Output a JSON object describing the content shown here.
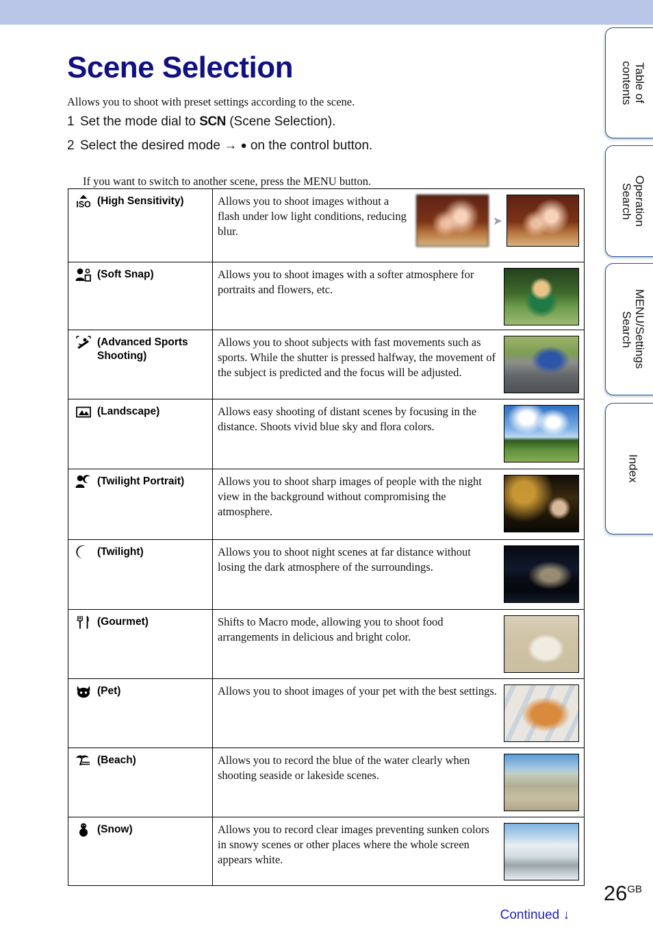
{
  "header": {
    "title": "Scene Selection",
    "band_color": "#b9c6e8",
    "title_color": "#101080"
  },
  "intro": "Allows you to shoot with preset settings according to the scene.",
  "steps": [
    {
      "number": "1",
      "text_before": "Set the mode dial to",
      "glyph": "SCN",
      "text_after": "(Scene Selection)."
    },
    {
      "number": "2",
      "text_before": "Select the desired mode",
      "arrow": "→",
      "dot": "●",
      "text_after": "on the control button."
    }
  ],
  "step_note": "If you want to switch to another scene, press the MENU button.",
  "table": {
    "rows": [
      {
        "icon": "high-sensitivity-icon",
        "label": "(High Sensitivity)",
        "description": "Allows you to shoot images without a flash under low light conditions, reducing blur.",
        "thumbnails": [
          "blurred-dinner-photo",
          "sharp-dinner-photo"
        ],
        "has_arrow": true
      },
      {
        "icon": "soft-snap-icon",
        "label": "(Soft Snap)",
        "description": "Allows you to shoot images with a softer atmosphere for portraits and flowers, etc.",
        "thumbnails": [
          "boy-in-grass-photo"
        ],
        "has_arrow": false
      },
      {
        "icon": "advanced-sports-shooting-icon",
        "label": "(Advanced Sports Shooting)",
        "description": "Allows you to shoot subjects with fast movements such as sports. While the shutter is pressed halfway, the movement of the subject is predicted and the focus will be adjusted.",
        "thumbnails": [
          "motorcycle-racer-photo"
        ],
        "has_arrow": false
      },
      {
        "icon": "landscape-icon",
        "label": "(Landscape)",
        "description": "Allows easy shooting of distant scenes by focusing in the distance. Shoots vivid blue sky and flora colors.",
        "thumbnails": [
          "field-and-sky-photo"
        ],
        "has_arrow": false
      },
      {
        "icon": "twilight-portrait-icon",
        "label": "(Twilight Portrait)",
        "description": "Allows you to shoot sharp images of people with the night view in the background without compromising the atmosphere.",
        "thumbnails": [
          "man-with-night-city-photo"
        ],
        "has_arrow": false
      },
      {
        "icon": "twilight-icon",
        "label": "(Twilight)",
        "description": "Allows you to shoot night scenes at far distance without losing the dark atmosphere of the surroundings.",
        "thumbnails": [
          "night-bridge-photo"
        ],
        "has_arrow": false
      },
      {
        "icon": "gourmet-icon",
        "label": "(Gourmet)",
        "description": "Shifts to Macro mode, allowing you to shoot food arrangements in delicious and bright color.",
        "thumbnails": [
          "plated-food-photo"
        ],
        "has_arrow": false
      },
      {
        "icon": "pet-icon",
        "label": "(Pet)",
        "description": "Allows you to shoot images of your pet with the best settings.",
        "thumbnails": [
          "orange-cat-photo"
        ],
        "has_arrow": false
      },
      {
        "icon": "beach-icon",
        "label": "(Beach)",
        "description": "Allows you to record the blue of the water clearly when shooting seaside or lakeside scenes.",
        "thumbnails": [
          "shallow-sea-photo"
        ],
        "has_arrow": false
      },
      {
        "icon": "snow-icon",
        "label": "(Snow)",
        "description": "Allows you to record clear images preventing sunken colors in snowy scenes or other places where the whole screen appears white.",
        "thumbnails": [
          "ski-slope-photo"
        ],
        "has_arrow": false
      }
    ]
  },
  "tabs": [
    {
      "name": "table-of-contents",
      "label": "Table of\ncontents"
    },
    {
      "name": "operation-search",
      "label": "Operation\nSearch"
    },
    {
      "name": "menu-settings-search",
      "label": "MENU/Settings\nSearch"
    },
    {
      "name": "index",
      "label": "Index"
    }
  ],
  "footer": {
    "page_number": "26",
    "page_suffix": "GB",
    "continued": "Continued",
    "continued_arrow": "↓",
    "continued_color": "#2222bb"
  }
}
